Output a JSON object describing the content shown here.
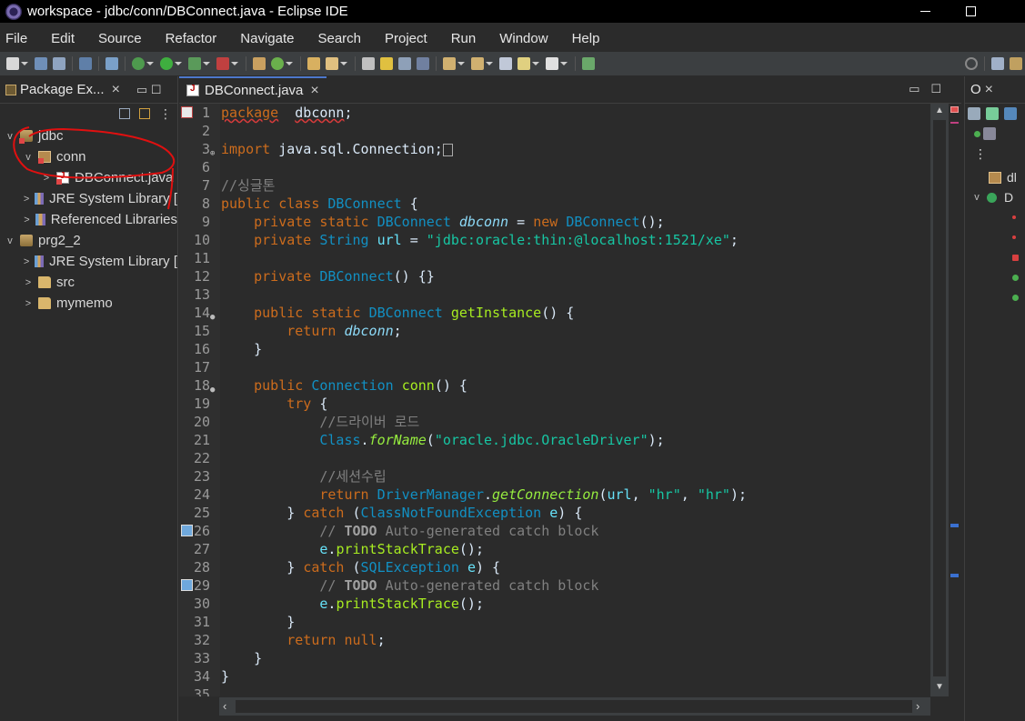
{
  "window": {
    "title": "workspace - jdbc/conn/DBConnect.java - Eclipse IDE"
  },
  "menu": [
    "File",
    "Edit",
    "Source",
    "Refactor",
    "Navigate",
    "Search",
    "Project",
    "Run",
    "Window",
    "Help"
  ],
  "package_explorer": {
    "tab_label": "Package Ex...",
    "tree": [
      {
        "label": "jdbc",
        "indent": 0,
        "chevron": "v",
        "icon": "project",
        "error": true
      },
      {
        "label": "conn",
        "indent": 1,
        "chevron": "v",
        "icon": "package",
        "error": true
      },
      {
        "label": "DBConnect.java",
        "indent": 2,
        "chevron": ">",
        "icon": "java",
        "error": true
      },
      {
        "label": "JRE System Library [",
        "indent": 1,
        "chevron": ">",
        "icon": "lib",
        "error": false
      },
      {
        "label": "Referenced Libraries",
        "indent": 1,
        "chevron": ">",
        "icon": "lib",
        "error": false
      },
      {
        "label": "prg2_2",
        "indent": 0,
        "chevron": "v",
        "icon": "project",
        "error": false
      },
      {
        "label": "JRE System Library [",
        "indent": 1,
        "chevron": ">",
        "icon": "lib",
        "error": false
      },
      {
        "label": "src",
        "indent": 1,
        "chevron": ">",
        "icon": "folder",
        "error": false
      },
      {
        "label": "mymemo",
        "indent": 1,
        "chevron": ">",
        "icon": "folder",
        "error": false
      }
    ]
  },
  "editor": {
    "tab_label": "DBConnect.java",
    "lines": [
      {
        "n": "1",
        "marker": "err",
        "segs": [
          [
            "kw squig",
            "package"
          ],
          [
            "",
            "  "
          ],
          [
            "squig",
            "dbconn"
          ],
          [
            "",
            ";"
          ]
        ]
      },
      {
        "n": "2",
        "segs": []
      },
      {
        "n": "3",
        "fold": "+",
        "segs": [
          [
            "kw",
            "import"
          ],
          [
            "",
            " java.sql.Connection;"
          ],
          [
            "box",
            ""
          ]
        ]
      },
      {
        "n": "6",
        "segs": []
      },
      {
        "n": "7",
        "segs": [
          [
            "cmt",
            "//싱글톤"
          ]
        ]
      },
      {
        "n": "8",
        "segs": [
          [
            "kw",
            "public"
          ],
          [
            "",
            " "
          ],
          [
            "kw",
            "class"
          ],
          [
            "",
            " "
          ],
          [
            "type",
            "DBConnect"
          ],
          [
            "",
            " {"
          ]
        ]
      },
      {
        "n": "9",
        "segs": [
          [
            "",
            "    "
          ],
          [
            "kw",
            "private"
          ],
          [
            "",
            " "
          ],
          [
            "kw",
            "static"
          ],
          [
            "",
            " "
          ],
          [
            "type",
            "DBConnect"
          ],
          [
            "",
            " "
          ],
          [
            "sfld",
            "dbconn"
          ],
          [
            "",
            " = "
          ],
          [
            "kw",
            "new"
          ],
          [
            "",
            " "
          ],
          [
            "type",
            "DBConnect"
          ],
          [
            "",
            "();"
          ]
        ]
      },
      {
        "n": "10",
        "segs": [
          [
            "",
            "    "
          ],
          [
            "kw",
            "private"
          ],
          [
            "",
            " "
          ],
          [
            "type",
            "String"
          ],
          [
            "",
            " "
          ],
          [
            "fld",
            "url"
          ],
          [
            "",
            " = "
          ],
          [
            "str",
            "\"jdbc:oracle:thin:@localhost:1521/xe\""
          ],
          [
            "",
            ";"
          ]
        ]
      },
      {
        "n": "11",
        "segs": []
      },
      {
        "n": "12",
        "segs": [
          [
            "",
            "    "
          ],
          [
            "kw",
            "private"
          ],
          [
            "",
            " "
          ],
          [
            "type",
            "DBConnect"
          ],
          [
            "",
            "() {}"
          ]
        ]
      },
      {
        "n": "13",
        "segs": []
      },
      {
        "n": "14",
        "fold": "-",
        "segs": [
          [
            "",
            "    "
          ],
          [
            "kw",
            "public"
          ],
          [
            "",
            " "
          ],
          [
            "kw",
            "static"
          ],
          [
            "",
            " "
          ],
          [
            "type",
            "DBConnect"
          ],
          [
            "",
            " "
          ],
          [
            "meth",
            "getInstance"
          ],
          [
            "",
            "() {"
          ]
        ]
      },
      {
        "n": "15",
        "segs": [
          [
            "",
            "        "
          ],
          [
            "kw",
            "return"
          ],
          [
            "",
            " "
          ],
          [
            "sfld",
            "dbconn"
          ],
          [
            "",
            ";"
          ]
        ]
      },
      {
        "n": "16",
        "segs": [
          [
            "",
            "    }"
          ]
        ]
      },
      {
        "n": "17",
        "segs": []
      },
      {
        "n": "18",
        "fold": "-",
        "segs": [
          [
            "",
            "    "
          ],
          [
            "kw",
            "public"
          ],
          [
            "",
            " "
          ],
          [
            "type",
            "Connection"
          ],
          [
            "",
            " "
          ],
          [
            "meth",
            "conn"
          ],
          [
            "",
            "() {"
          ]
        ]
      },
      {
        "n": "19",
        "segs": [
          [
            "",
            "        "
          ],
          [
            "kw",
            "try"
          ],
          [
            "",
            " {"
          ]
        ]
      },
      {
        "n": "20",
        "segs": [
          [
            "",
            "            "
          ],
          [
            "cmt",
            "//드라이버 로드"
          ]
        ]
      },
      {
        "n": "21",
        "segs": [
          [
            "",
            "            "
          ],
          [
            "type",
            "Class"
          ],
          [
            "",
            "."
          ],
          [
            "smeth",
            "forName"
          ],
          [
            "",
            "("
          ],
          [
            "str",
            "\"oracle.jdbc.OracleDriver\""
          ],
          [
            "",
            ");"
          ]
        ]
      },
      {
        "n": "22",
        "segs": []
      },
      {
        "n": "23",
        "segs": [
          [
            "",
            "            "
          ],
          [
            "cmt",
            "//세션수립"
          ]
        ]
      },
      {
        "n": "24",
        "segs": [
          [
            "",
            "            "
          ],
          [
            "kw",
            "return"
          ],
          [
            "",
            " "
          ],
          [
            "type",
            "DriverManager"
          ],
          [
            "",
            "."
          ],
          [
            "smeth",
            "getConnection"
          ],
          [
            "",
            "("
          ],
          [
            "fld",
            "url"
          ],
          [
            "",
            ", "
          ],
          [
            "str",
            "\"hr\""
          ],
          [
            "",
            ", "
          ],
          [
            "str",
            "\"hr\""
          ],
          [
            "",
            ");"
          ]
        ]
      },
      {
        "n": "25",
        "segs": [
          [
            "",
            "        } "
          ],
          [
            "kw",
            "catch"
          ],
          [
            "",
            " ("
          ],
          [
            "type",
            "ClassNotFoundException"
          ],
          [
            "",
            " "
          ],
          [
            "fld",
            "e"
          ],
          [
            "",
            ") {"
          ]
        ]
      },
      {
        "n": "26",
        "marker": "task",
        "segs": [
          [
            "",
            "            "
          ],
          [
            "cmt",
            "// "
          ],
          [
            "todo",
            "TODO"
          ],
          [
            "cmt",
            " Auto-generated catch block"
          ]
        ]
      },
      {
        "n": "27",
        "segs": [
          [
            "",
            "            "
          ],
          [
            "fld",
            "e"
          ],
          [
            "",
            "."
          ],
          [
            "meth",
            "printStackTrace"
          ],
          [
            "",
            "();"
          ]
        ]
      },
      {
        "n": "28",
        "segs": [
          [
            "",
            "        } "
          ],
          [
            "kw",
            "catch"
          ],
          [
            "",
            " ("
          ],
          [
            "type",
            "SQLException"
          ],
          [
            "",
            " "
          ],
          [
            "fld",
            "e"
          ],
          [
            "",
            ") {"
          ]
        ]
      },
      {
        "n": "29",
        "marker": "task",
        "segs": [
          [
            "",
            "            "
          ],
          [
            "cmt",
            "// "
          ],
          [
            "todo",
            "TODO"
          ],
          [
            "cmt",
            " Auto-generated catch block"
          ]
        ]
      },
      {
        "n": "30",
        "segs": [
          [
            "",
            "            "
          ],
          [
            "fld",
            "e"
          ],
          [
            "",
            "."
          ],
          [
            "meth",
            "printStackTrace"
          ],
          [
            "",
            "();"
          ]
        ]
      },
      {
        "n": "31",
        "segs": [
          [
            "",
            "        }"
          ]
        ]
      },
      {
        "n": "32",
        "segs": [
          [
            "",
            "        "
          ],
          [
            "kw",
            "return"
          ],
          [
            "",
            " "
          ],
          [
            "kw",
            "null"
          ],
          [
            "",
            ";"
          ]
        ]
      },
      {
        "n": "33",
        "segs": [
          [
            "",
            "    }"
          ]
        ]
      },
      {
        "n": "34",
        "segs": [
          [
            "",
            "}"
          ]
        ]
      },
      {
        "n": "35",
        "segs": []
      }
    ]
  },
  "outline": {
    "tab_label": "O",
    "rows": [
      "dl",
      "D"
    ]
  },
  "colors": {
    "accent": "#4d78cc",
    "annotation": "#e01010"
  }
}
